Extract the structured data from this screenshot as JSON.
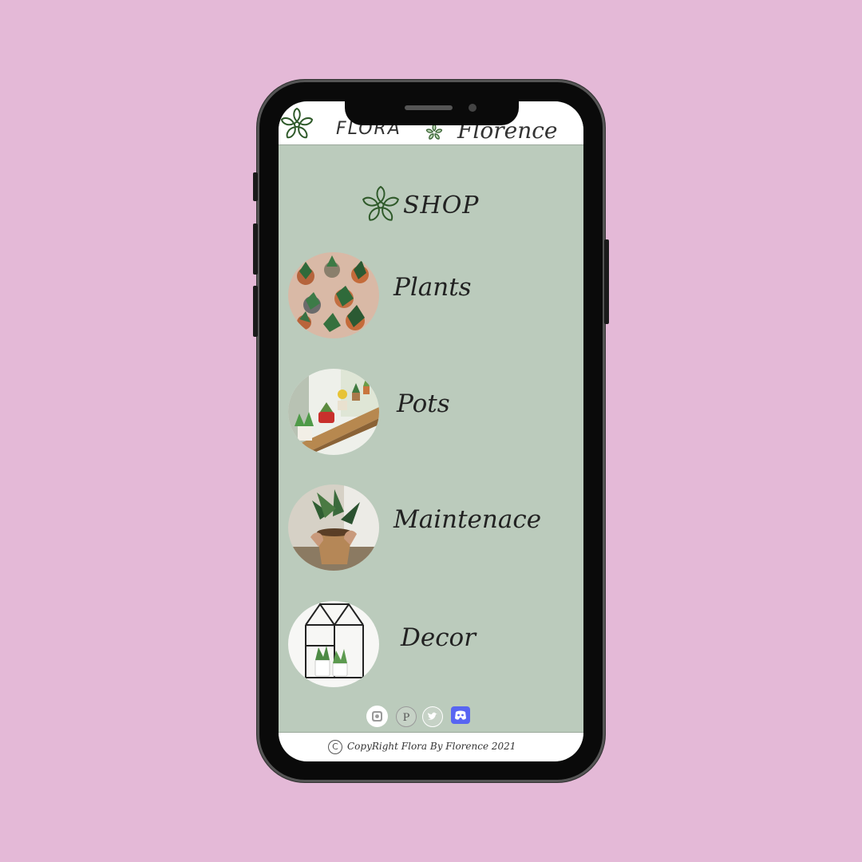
{
  "header": {
    "brand_left": "FLORA",
    "brand_right": "Florence",
    "logo_icon": "flower-outline-icon"
  },
  "shop": {
    "title": "SHOP",
    "icon": "flower-outline-icon"
  },
  "categories": [
    {
      "label": "Plants",
      "image": "potted-plants-top-view"
    },
    {
      "label": "Pots",
      "image": "windowsill-pots"
    },
    {
      "label": "Maintenace",
      "image": "repotting-hands"
    },
    {
      "label": "Decor",
      "image": "glass-terrarium"
    }
  ],
  "socials": [
    {
      "name": "instagram",
      "icon": "instagram-icon"
    },
    {
      "name": "pinterest",
      "icon": "pinterest-icon"
    },
    {
      "name": "twitter",
      "icon": "twitter-icon"
    },
    {
      "name": "discord",
      "icon": "discord-icon"
    }
  ],
  "footer": {
    "copyright_symbol": "C",
    "copyright_text": "CopyRight Flora By Florence 2021"
  },
  "colors": {
    "page_background": "#e4b9d7",
    "screen_background": "#bbcbbc",
    "accent_green": "#2f5a2a",
    "discord_blue": "#5865f2"
  }
}
